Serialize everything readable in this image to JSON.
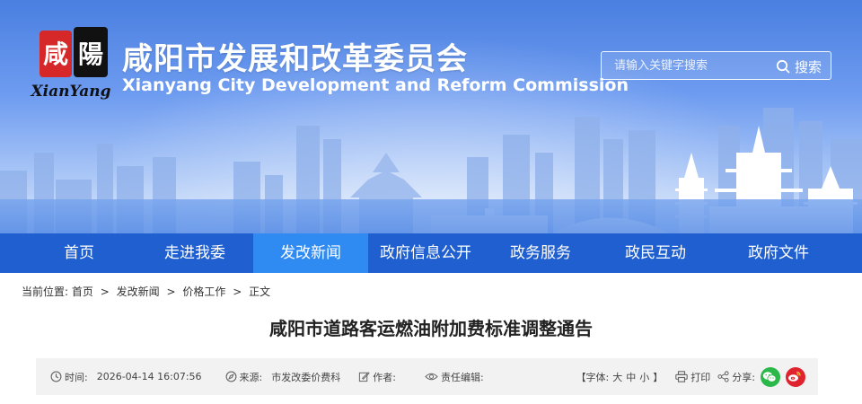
{
  "header": {
    "logo_chars": "咸陽",
    "logo_sub": "XianYang",
    "title_cn": "咸阳市发展和改革委员会",
    "title_en": "Xianyang City Development and Reform Commission"
  },
  "search": {
    "placeholder": "请输入关键字搜索",
    "button_label": "搜索"
  },
  "nav": {
    "items": [
      {
        "label": "首页"
      },
      {
        "label": "走进我委"
      },
      {
        "label": "发改新闻"
      },
      {
        "label": "政府信息公开"
      },
      {
        "label": "政务服务"
      },
      {
        "label": "政民互动"
      },
      {
        "label": "政府文件"
      }
    ],
    "active_index": 2
  },
  "breadcrumb": {
    "prefix": "当前位置:",
    "items": [
      "首页",
      "发改新闻",
      "价格工作",
      "正文"
    ],
    "separator": ">"
  },
  "article": {
    "title": "咸阳市道路客运燃油附加费标准调整通告",
    "time_label": "时间:",
    "time_value": "2026-04-14 16:07:56",
    "source_label": "来源:",
    "source_value": "市发改委价费科",
    "author_label": "作者:",
    "editor_label": "责任编辑:",
    "font_open": "【字体:",
    "font_large": "大",
    "font_medium": "中",
    "font_small": "小",
    "font_close": "】",
    "print_label": "打印",
    "share_label": "分享:"
  },
  "colors": {
    "nav_bg": "#1f5fd0",
    "nav_active": "#2f8af2",
    "wechat": "#2bb84a",
    "weibo": "#e0242f"
  }
}
